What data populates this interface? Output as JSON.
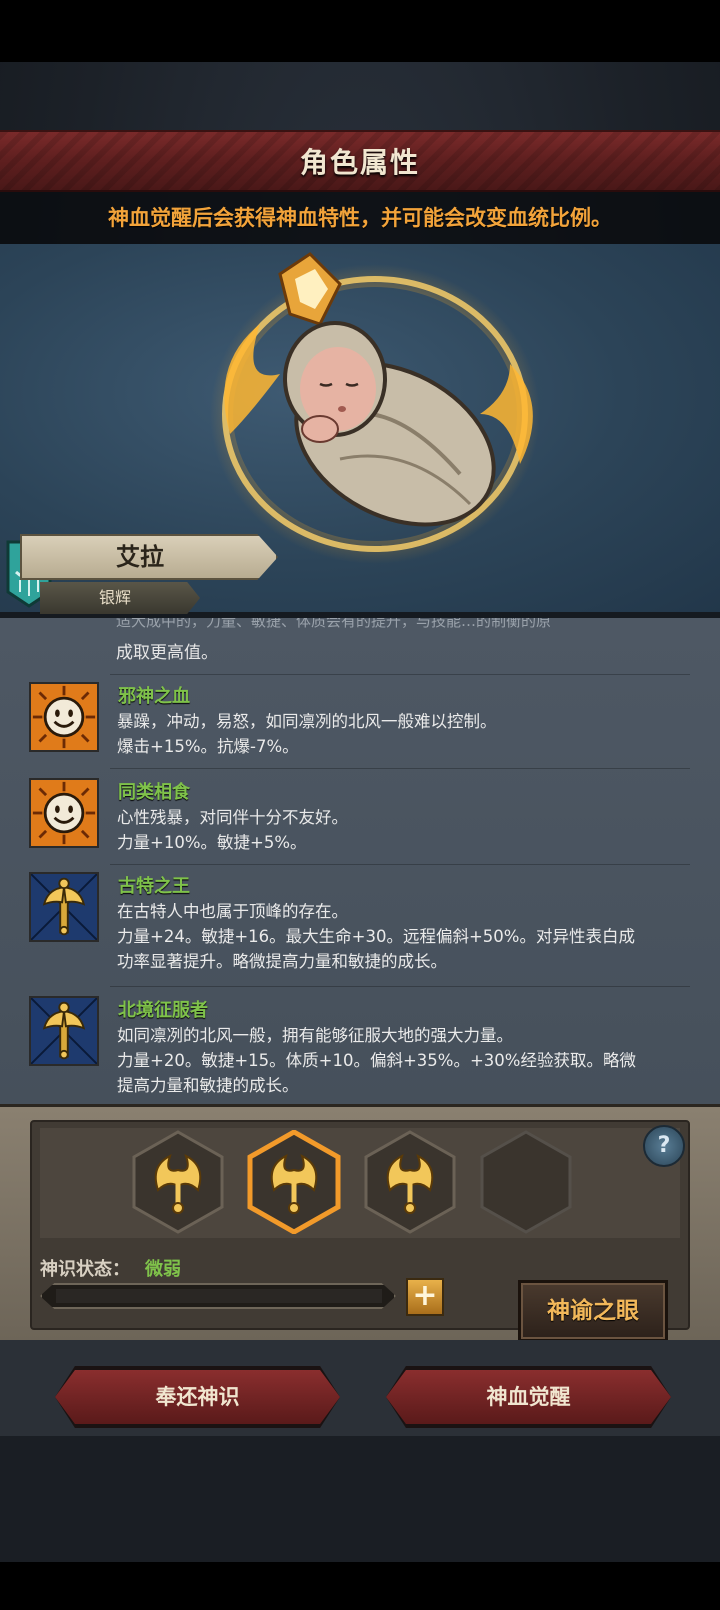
{
  "header": {
    "title": "角色属性"
  },
  "notice": "神血觉醒后会获得神血特性，并可能会改变血统比例。",
  "character": {
    "name": "艾拉",
    "rank": "银辉"
  },
  "traits_list": {
    "partial_top": "适大成中的，力量、敏捷、体质会有的提升，与技能…的制衡的原",
    "partial_text": "成取更高值。",
    "items": [
      {
        "name": "邪神之血",
        "icon": "smiley-icon",
        "desc": [
          "暴躁，冲动，易怒，如同凛冽的北风一般难以控制。",
          "爆击+15%。抗爆-7%。"
        ]
      },
      {
        "name": "同类相食",
        "icon": "smiley-icon",
        "desc": [
          "心性残暴，对同伴十分不友好。",
          "力量+10%。敏捷+5%。"
        ]
      },
      {
        "name": "古特之王",
        "icon": "axe-icon",
        "desc": [
          "在古特人中也属于顶峰的存在。",
          "力量+24。敏捷+16。最大生命+30。远程偏斜+50%。对异性表白成",
          "功率显著提升。略微提高力量和敏捷的成长。"
        ]
      },
      {
        "name": "北境征服者",
        "icon": "axe-icon",
        "desc": [
          "如同凛冽的北风一般，拥有能够征服大地的强大力量。",
          "力量+20。敏捷+15。体质+10。偏斜+35%。+30%经验获取。略微",
          "提高力量和敏捷的成长。"
        ]
      }
    ]
  },
  "awaken": {
    "help_label": "?",
    "state_label": "神识状态：",
    "state_value": "微弱",
    "plus_label": "+",
    "oracle_label": "神谕之眼",
    "slots": [
      "filled",
      "selected",
      "filled",
      "empty"
    ]
  },
  "footer": {
    "return_label": "奉还神识",
    "awaken_label": "神血觉醒"
  },
  "colors": {
    "accent_green": "#7fc24a",
    "accent_orange": "#f2a33a",
    "header_red": "#7a2a2a"
  }
}
